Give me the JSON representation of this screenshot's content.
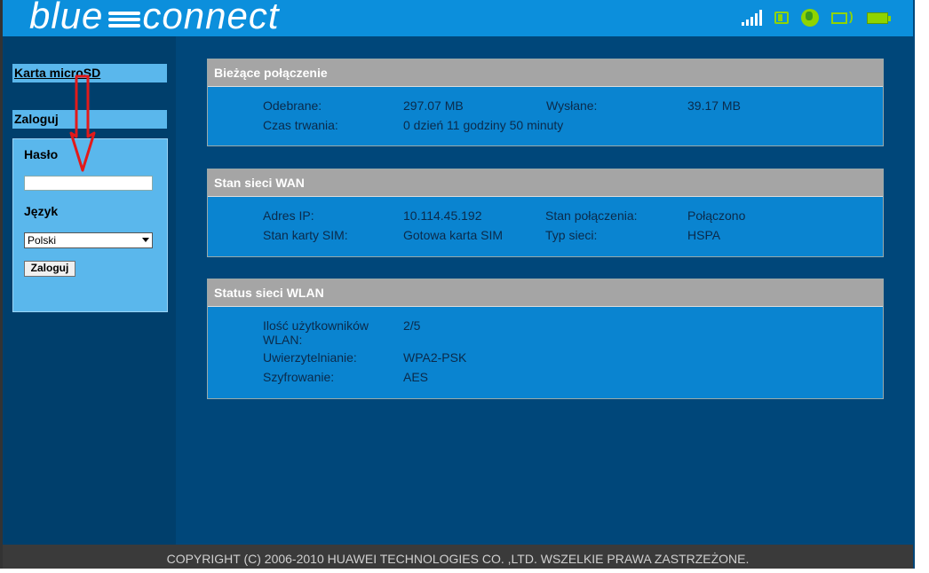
{
  "header": {
    "logo_left": "blue",
    "logo_right": "connect",
    "icons": [
      "signal-icon",
      "sim-icon",
      "globe-icon",
      "wlan-icon",
      "battery-icon"
    ],
    "accent_color": "#0c8fdc",
    "status_color": "#8fd400"
  },
  "sidebar": {
    "sd_card_link": "Karta microSD",
    "login_title": "Zaloguj",
    "password_label": "Hasło",
    "password_value": "",
    "language_label": "Język",
    "language_selected": "Polski",
    "login_button": "Zaloguj"
  },
  "panels": {
    "current_connection": {
      "title": "Bieżące połączenie",
      "received_label": "Odebrane:",
      "received_value": "297.07 MB",
      "sent_label": "Wysłane:",
      "sent_value": "39.17 MB",
      "duration_label": "Czas trwania:",
      "duration_value": "0 dzień 11 godziny 50 minuty"
    },
    "wan": {
      "title": "Stan sieci WAN",
      "ip_label": "Adres IP:",
      "ip_value": "10.114.45.192",
      "conn_label": "Stan połączenia:",
      "conn_value": "Połączono",
      "sim_label": "Stan karty SIM:",
      "sim_value": "Gotowa karta SIM",
      "net_label": "Typ sieci:",
      "net_value": "HSPA"
    },
    "wlan": {
      "title": "Status sieci WLAN",
      "users_label_line1": "Ilość użytkowników",
      "users_label_line2": "WLAN:",
      "users_value": "2/5",
      "auth_label": "Uwierzytelnianie:",
      "auth_value": "WPA2-PSK",
      "enc_label": "Szyfrowanie:",
      "enc_value": "AES"
    }
  },
  "footer": {
    "copyright": "COPYRIGHT (C) 2006-2010 HUAWEI TECHNOLOGIES CO. ,LTD. WSZELKIE PRAWA ZASTRZEŻONE."
  }
}
